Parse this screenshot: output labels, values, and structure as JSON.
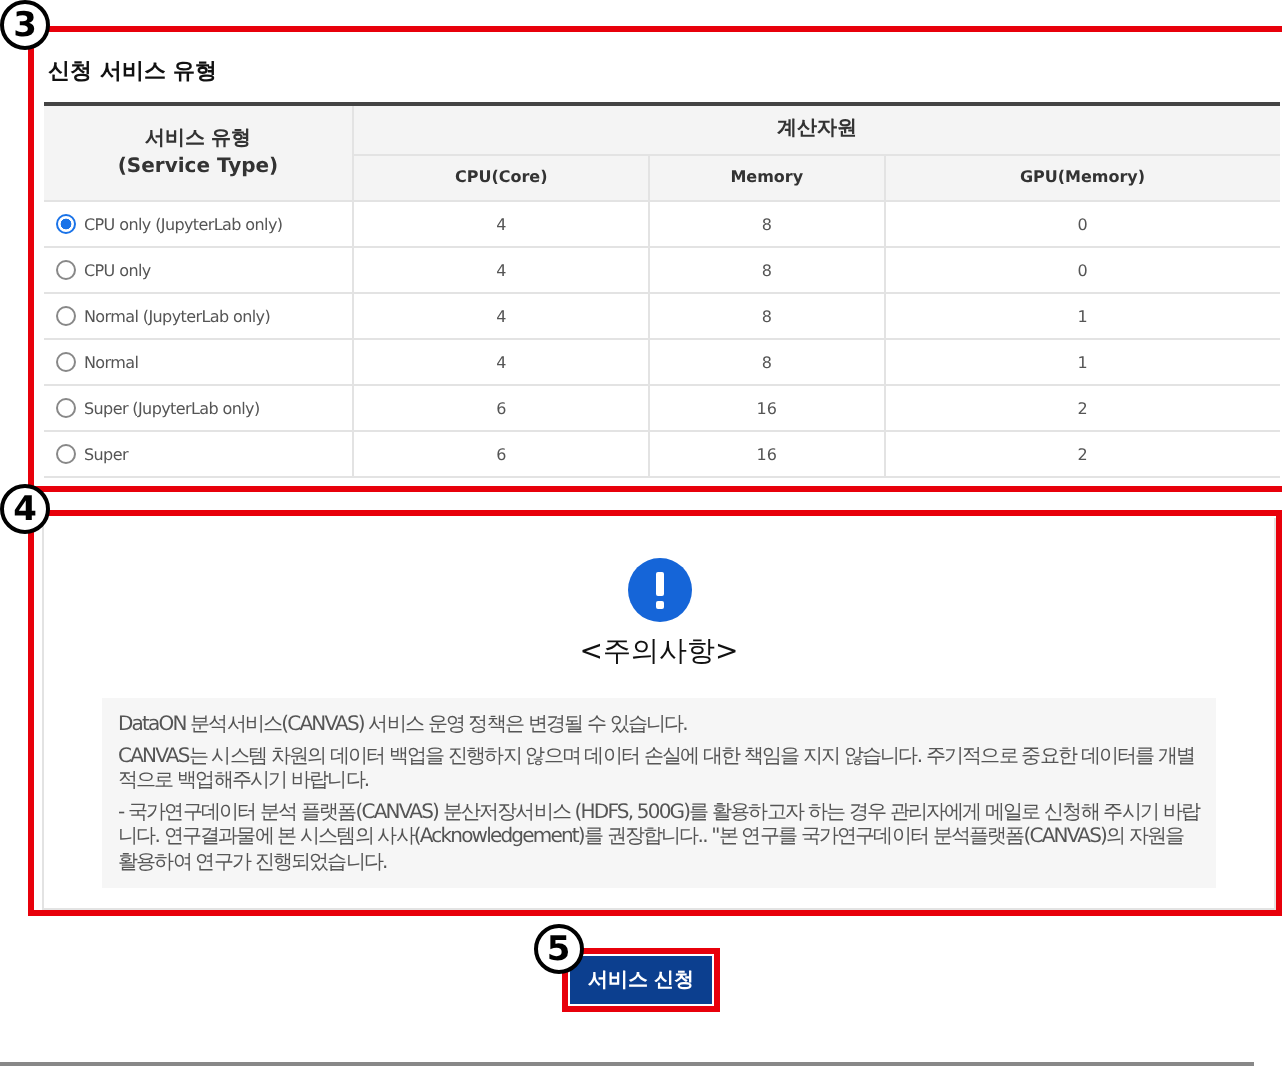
{
  "service_type_section": {
    "callout": "3",
    "title": "신청 서비스 유형",
    "table": {
      "group_header": "서비스 유형\n(Service Type)",
      "resource_header": "계산자원",
      "columns": [
        "CPU(Core)",
        "Memory",
        "GPU(Memory)"
      ],
      "rows": [
        {
          "label": "CPU only (JupyterLab only)",
          "selected": true,
          "cells": [
            "4",
            "8",
            "0"
          ]
        },
        {
          "label": "CPU only",
          "selected": false,
          "cells": [
            "4",
            "8",
            "0"
          ]
        },
        {
          "label": "Normal (JupyterLab only)",
          "selected": false,
          "cells": [
            "4",
            "8",
            "1"
          ]
        },
        {
          "label": "Normal",
          "selected": false,
          "cells": [
            "4",
            "8",
            "1"
          ]
        },
        {
          "label": "Super (JupyterLab only)",
          "selected": false,
          "cells": [
            "6",
            "16",
            "2"
          ]
        },
        {
          "label": "Super",
          "selected": false,
          "cells": [
            "6",
            "16",
            "2"
          ]
        }
      ]
    }
  },
  "notice_section": {
    "callout": "4",
    "title": "<주의사항>",
    "paragraphs": [
      "DataON 분석서비스(CANVAS) 서비스 운영 정책은 변경될 수 있습니다.",
      "CANVAS는 시스템 차원의 데이터 백업을 진행하지 않으며 데이터 손실에 대한 책임을 지지 않습니다. 주기적으로 중요한 데이터를 개별적으로 백업해주시기 바랍니다.",
      "- 국가연구데이터 분석 플랫폼(CANVAS) 분산저장서비스 (HDFS, 500G)를 활용하고자 하는 경우 관리자에게 메일로 신청해 주시기 바랍니다. 연구결과물에 본 시스템의 사사(Acknowledgement)를 권장합니다.. \"본 연구를 국가연구데이터 분석플랫폼(CANVAS)의 자원을 활용하여 연구가 진행되었습니다."
    ]
  },
  "submit": {
    "callout": "5",
    "label": "서비스 신청"
  }
}
